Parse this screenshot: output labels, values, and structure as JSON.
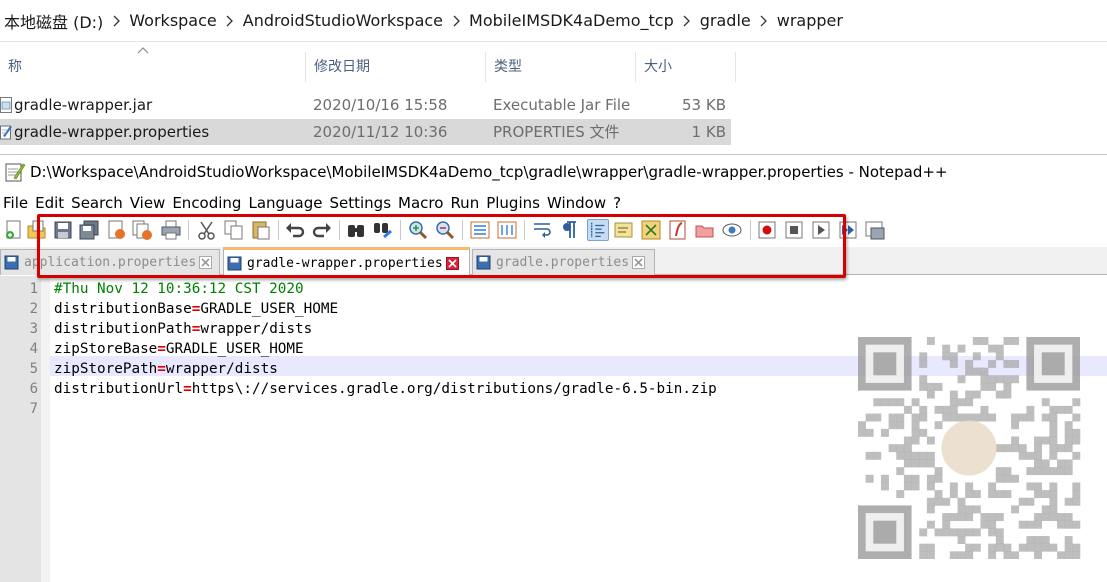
{
  "explorer": {
    "breadcrumb": [
      "本地磁盘 (D:)",
      "Workspace",
      "AndroidStudioWorkspace",
      "MobileIMSDK4aDemo_tcp",
      "gradle",
      "wrapper"
    ],
    "columns": {
      "name": "称",
      "date": "修改日期",
      "type": "类型",
      "size": "大小"
    },
    "files": [
      {
        "name": "gradle-wrapper.jar",
        "date": "2020/10/16 15:58",
        "type": "Executable Jar File",
        "size": "53 KB",
        "icon": "jar-file-icon"
      },
      {
        "name": "gradle-wrapper.properties",
        "date": "2020/11/12 10:36",
        "type": "PROPERTIES 文件",
        "size": "1 KB",
        "icon": "properties-file-icon",
        "selected": true
      }
    ]
  },
  "notepad": {
    "title": "D:\\Workspace\\AndroidStudioWorkspace\\MobileIMSDK4aDemo_tcp\\gradle\\wrapper\\gradle-wrapper.properties - Notepad++",
    "menu": [
      "File",
      "Edit",
      "Search",
      "View",
      "Encoding",
      "Language",
      "Settings",
      "Macro",
      "Run",
      "Plugins",
      "Window",
      "?"
    ],
    "tabs": [
      {
        "label": "application.properties",
        "active": false
      },
      {
        "label": "gradle-wrapper.properties",
        "active": true
      },
      {
        "label": "gradle.properties",
        "active": false
      }
    ],
    "line_numbers": [
      "1",
      "2",
      "3",
      "4",
      "5",
      "6",
      "7"
    ],
    "lines": [
      {
        "comment": "#Thu Nov 12 10:36:12 CST 2020"
      },
      {
        "key": "distributionBase",
        "eq": "=",
        "value": "GRADLE_USER_HOME"
      },
      {
        "key": "distributionPath",
        "eq": "=",
        "value": "wrapper/dists"
      },
      {
        "key": "zipStoreBase",
        "eq": "=",
        "value": "GRADLE_USER_HOME"
      },
      {
        "key": "zipStorePath",
        "eq": "=",
        "value": "wrapper/dists"
      },
      {
        "key": "distributionUrl",
        "eq": "=",
        "value": "https\\://services.gradle.org/distributions/gradle-6.5-bin.zip"
      },
      {
        "comment": ""
      }
    ]
  },
  "colors": {
    "highlight_box": "#d60000",
    "comment": "#008000",
    "operator": "#e00000",
    "selected_row": "#d9d9d9",
    "active_tab_accent": "#fab96c"
  }
}
